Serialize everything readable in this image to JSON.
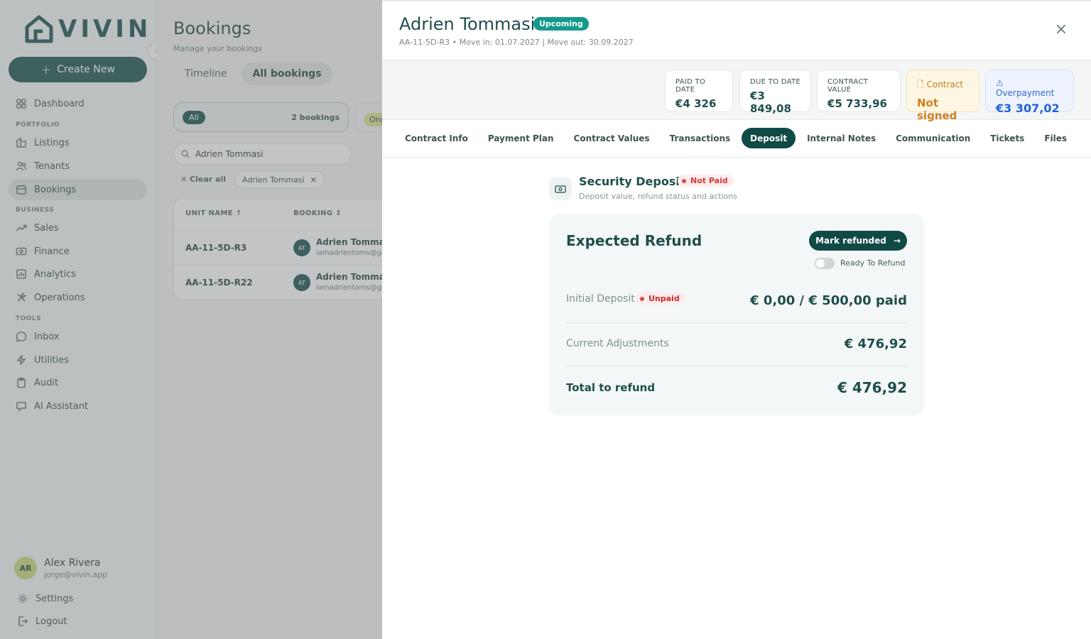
{
  "app": {
    "logo_text": "VIVIN",
    "create_label": "Create New"
  },
  "sidebar": {
    "sections": {
      "portfolio": "PORTFOLIO",
      "business": "BUSINESS",
      "tools": "TOOLS"
    },
    "items": [
      {
        "label": "Dashboard",
        "icon": "dashboard-icon"
      },
      {
        "label": "Listings",
        "icon": "listings-icon"
      },
      {
        "label": "Tenants",
        "icon": "tenants-icon"
      },
      {
        "label": "Bookings",
        "icon": "bookings-icon",
        "active": true
      },
      {
        "label": "Sales",
        "icon": "sales-icon"
      },
      {
        "label": "Finance",
        "icon": "finance-icon"
      },
      {
        "label": "Analytics",
        "icon": "analytics-icon"
      },
      {
        "label": "Operations",
        "icon": "operations-icon"
      },
      {
        "label": "Inbox",
        "icon": "inbox-icon"
      },
      {
        "label": "Utilities",
        "icon": "utilities-icon"
      },
      {
        "label": "Audit",
        "icon": "audit-icon"
      },
      {
        "label": "AI Assistant",
        "icon": "ai-assistant-icon"
      }
    ],
    "user": {
      "initials": "AR",
      "name": "Alex Rivera",
      "email": "jorge@vivin.app"
    },
    "settings_label": "Settings",
    "logout_label": "Logout"
  },
  "bookings_page": {
    "title": "Bookings",
    "subtitle": "Manage your bookings",
    "view_tabs": [
      "Timeline",
      "All bookings"
    ],
    "filter_all": "All",
    "filter_count": "2 bookings",
    "filter_ongoing": "Ong",
    "search_value": "Adrien Tommasi",
    "clear_all": "Clear all",
    "chip": "Adrien Tommasi",
    "columns": [
      "UNIT NAME ↑",
      "BOOKING ↕"
    ],
    "rows": [
      {
        "unit": "AA-11-5D-R3",
        "initials": "AT",
        "name": "Adrien Tommasi",
        "email": "lamadrientoms@gmail.com"
      },
      {
        "unit": "AA-11-5D-R22",
        "initials": "AT",
        "name": "Adrien Tommasi",
        "email": "lamadrientoms@gmail.com"
      }
    ]
  },
  "drawer": {
    "title": "Adrien Tommasi",
    "status_badge": "Upcoming",
    "subtitle": "AA-11-5D-R3 • Move in: 01.07.2027 | Move out: 30.09.2027",
    "stats": [
      {
        "label": "PAID TO DATE",
        "value": "€4 326"
      },
      {
        "label": "DUE TO DATE",
        "value": "€3 849,08"
      },
      {
        "label": "CONTRACT VALUE",
        "value": "€5 733,96"
      },
      {
        "label": "Contract",
        "value": "Not signed"
      },
      {
        "label": "Overpayment",
        "value": "€3 307,02"
      }
    ],
    "tabs": [
      "Contract Info",
      "Payment Plan",
      "Contract Values",
      "Transactions",
      "Deposit",
      "Internal Notes",
      "Communication",
      "Tickets",
      "Files"
    ],
    "active_tab": "Deposit",
    "deposit": {
      "title": "Security Deposit",
      "status": "Not Paid",
      "subtitle": "Deposit value, refund status and actions",
      "card_title": "Expected Refund",
      "mark_refunded": "Mark refunded",
      "ready_label": "Ready To Refund",
      "ready_on": false,
      "initial_label": "Initial Deposit",
      "initial_badge": "Unpaid",
      "initial_value": "€ 0,00 / € 500,00 paid",
      "adjust_label": "Current Adjustments",
      "adjust_value": "€ 476,92",
      "total_label": "Total to refund",
      "total_value": "€ 476,92"
    }
  },
  "colors": {
    "brand": "#104a46",
    "accent_teal": "#139a8c",
    "danger": "#e24747",
    "warn": "#d2801b",
    "info": "#2561d4"
  }
}
